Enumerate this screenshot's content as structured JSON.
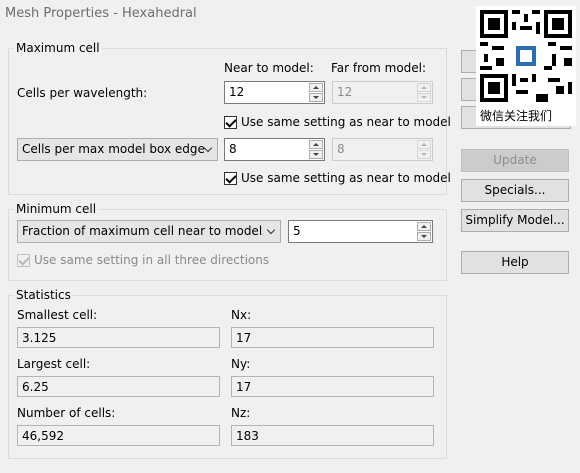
{
  "window": {
    "title": "Mesh Properties - Hexahedral"
  },
  "maximum_cell": {
    "legend": "Maximum cell",
    "col_near": "Near to model:",
    "col_far": "Far from model:",
    "row1_label": "Cells per wavelength:",
    "row1_near": "12",
    "row1_far": "12",
    "row1_same": "Use same setting as near to model",
    "row2_combo": "Cells per max model box edge",
    "row2_near": "8",
    "row2_far": "8",
    "row2_same": "Use same setting as near to model"
  },
  "minimum_cell": {
    "legend": "Minimum cell",
    "combo": "Fraction of maximum cell near to model",
    "value": "5",
    "all_dirs": "Use same setting in all three directions"
  },
  "statistics": {
    "legend": "Statistics",
    "smallest_label": "Smallest cell:",
    "smallest_value": "3.125",
    "largest_label": "Largest cell:",
    "largest_value": "6.25",
    "count_label": "Number of cells:",
    "count_value": "46,592",
    "nx_label": "Nx:",
    "nx_value": "17",
    "ny_label": "Ny:",
    "ny_value": "17",
    "nz_label": "Nz:",
    "nz_value": "183"
  },
  "buttons": {
    "update": "Update",
    "specials": "Specials...",
    "simplify": "Simplify Model...",
    "help": "Help"
  },
  "overlay": {
    "qr_caption": "微信关注我们"
  }
}
